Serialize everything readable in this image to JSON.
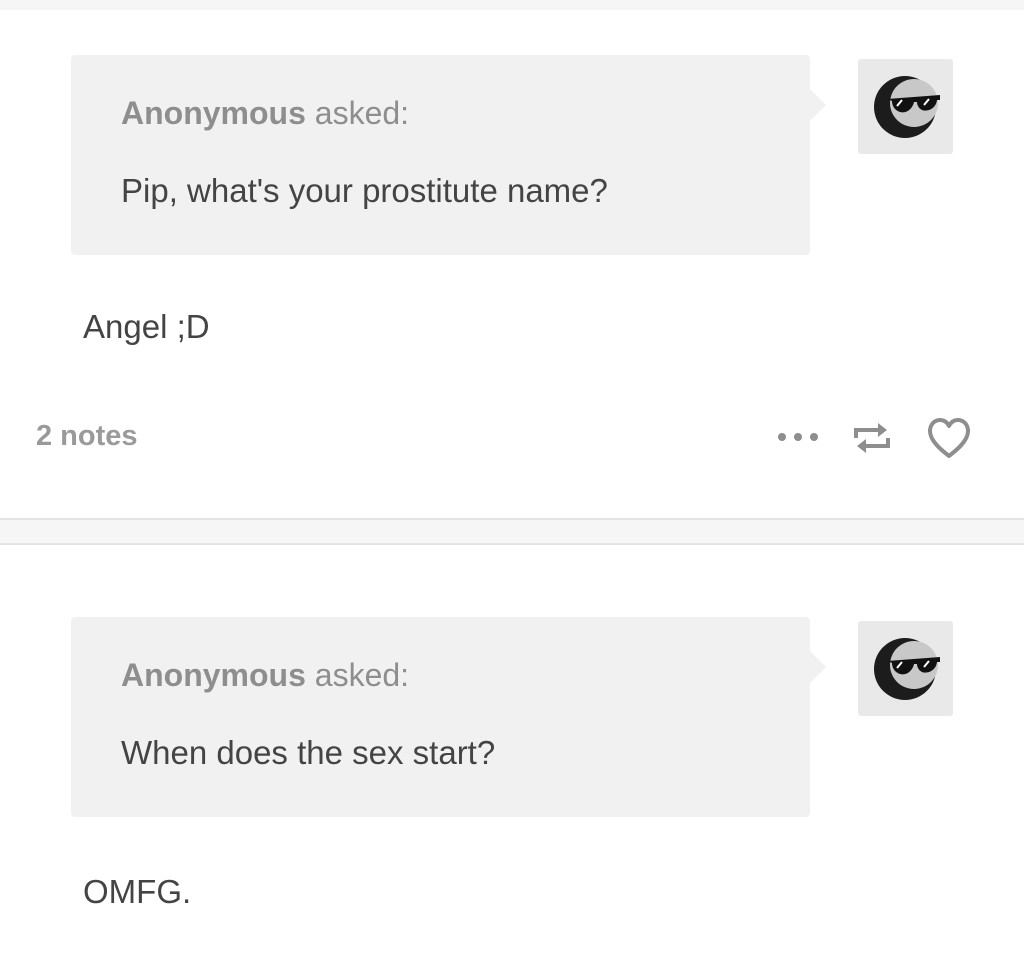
{
  "posts": [
    {
      "asker": "Anonymous",
      "asked_label": "asked:",
      "question": "Pip, what's your prostitute name?",
      "answer": "Angel ;D",
      "notes": "2 notes",
      "avatar_icon": "sunglasses-moon-avatar-icon",
      "action_icons": [
        "more-icon",
        "reblog-icon",
        "like-icon"
      ]
    },
    {
      "asker": "Anonymous",
      "asked_label": "asked:",
      "question": "When does the sex start?",
      "answer": "OMFG.",
      "avatar_icon": "sunglasses-moon-avatar-icon"
    }
  ],
  "colors": {
    "bubble": "#f1f1f1",
    "text": "#444444",
    "muted": "#8e8e8e",
    "separator": "#e4e4e4"
  }
}
